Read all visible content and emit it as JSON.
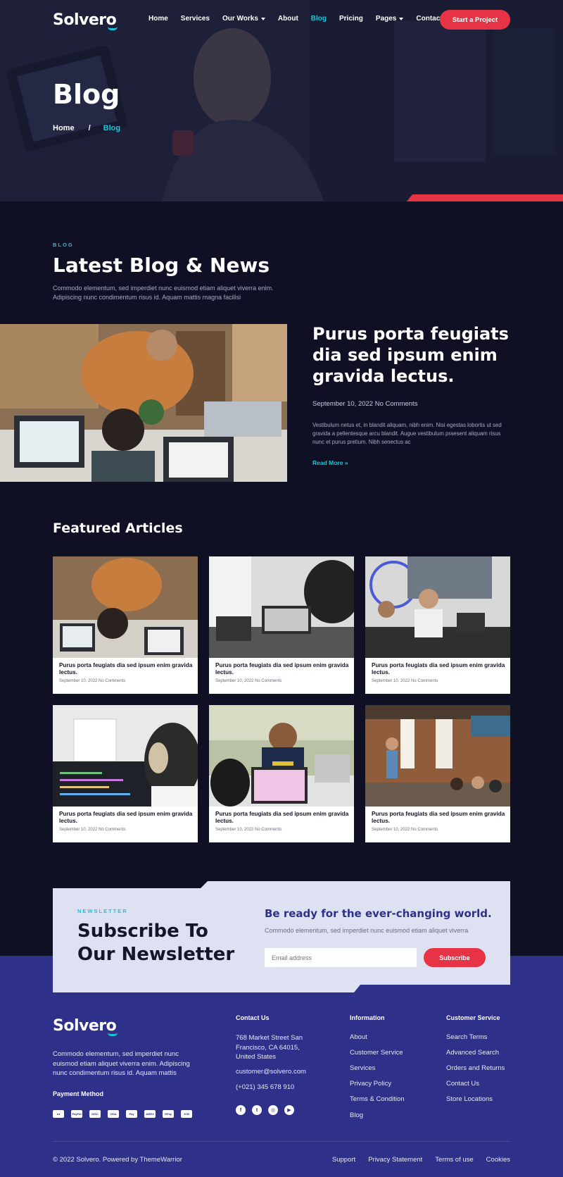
{
  "colors": {
    "accent_cyan": "#1bc5d6",
    "accent_red": "#e63346",
    "dark_bg": "#0f1024",
    "footer_bg": "#2e3089"
  },
  "brand": {
    "logo": "Solvero"
  },
  "nav": {
    "items": [
      {
        "label": "Home"
      },
      {
        "label": "Services"
      },
      {
        "label": "Our Works",
        "dropdown": true
      },
      {
        "label": "About"
      },
      {
        "label": "Blog",
        "active": true
      },
      {
        "label": "Pricing"
      },
      {
        "label": "Pages",
        "dropdown": true
      },
      {
        "label": "Contact"
      }
    ],
    "cta": "Start a Project"
  },
  "hero": {
    "title": "Blog",
    "breadcrumb": {
      "home": "Home",
      "sep": "/",
      "current": "Blog"
    }
  },
  "latest": {
    "eyebrow": "BLOG",
    "title": "Latest Blog & News",
    "description": "Commodo elementum, sed imperdiet nunc euismod etiam aliquet viverra enim. Adipiscing nunc condimentum risus id. Aquam mattis magna facilisi",
    "post": {
      "title": "Purus porta feugiats dia sed ipsum enim gravida lectus.",
      "meta": "September 10, 2022 No Comments",
      "excerpt": "Vestibulum netus et, in blandit aliquam, nibh enim. Nisi egestas lobortis ut sed gravida a pellentesque arcu blandit. Augue vestibulum praesent aliquam risus nunc et purus pretium. Nibh senectus ac",
      "read_more": "Read More »"
    }
  },
  "featured": {
    "title": "Featured Articles",
    "cards": [
      {
        "title": "Purus porta feugiats dia sed ipsum enim gravida lectus.",
        "meta": "September 10, 2022 No Comments"
      },
      {
        "title": "Purus porta feugiats dia sed ipsum enim gravida lectus.",
        "meta": "September 10, 2022 No Comments"
      },
      {
        "title": "Purus porta feugiats dia sed ipsum enim gravida lectus.",
        "meta": "September 10, 2022 No Comments"
      },
      {
        "title": "Purus porta feugiats dia sed ipsum enim gravida lectus.",
        "meta": "September 10, 2022 No Comments"
      },
      {
        "title": "Purus porta feugiats dia sed ipsum enim gravida lectus.",
        "meta": "September 10, 2022 No Comments"
      },
      {
        "title": "Purus porta feugiats dia sed ipsum enim gravida lectus.",
        "meta": "September 10, 2022 No Comments"
      }
    ]
  },
  "newsletter": {
    "eyebrow": "NEWSLETTER",
    "title": "Subscribe To Our Newsletter",
    "heading": "Be ready for the ever-changing world.",
    "description": "Commodo elementum, sed imperdiet nunc euismod etiam aliquet viverra",
    "placeholder": "Email address",
    "button": "Subscribe"
  },
  "footer": {
    "description": "Commodo elementum, sed imperdiet nunc euismod etiam aliquet viverra enim. Adipiscing nunc condimentum risus id. Aquam mattis",
    "payment_title": "Payment Method",
    "payment_icons": [
      "mastercard",
      "PayPal",
      "DISC",
      "VISA",
      "Pay",
      "AMEX",
      "GPay",
      "JCB"
    ],
    "contact": {
      "title": "Contact Us",
      "address": "768 Market Street San Francisco, CA 64015, United States",
      "email": "customer@solvero.com",
      "phone": "(+021) 345 678 910",
      "socials": [
        "f",
        "t",
        "◎",
        "▶"
      ]
    },
    "information": {
      "title": "Information",
      "links": [
        "About",
        "Customer Service",
        "Services",
        "Privacy Policy",
        "Terms & Condition",
        "Blog"
      ]
    },
    "customer_service": {
      "title": "Customer Service",
      "links": [
        "Search Terms",
        "Advanced Search",
        "Orders and Returns",
        "Contact Us",
        "Store Locations"
      ]
    },
    "copyright": "© 2022 Solvero. Powered by ThemeWarrior",
    "bottom_links": [
      "Support",
      "Privacy Statement",
      "Terms of use",
      "Cookies"
    ]
  }
}
